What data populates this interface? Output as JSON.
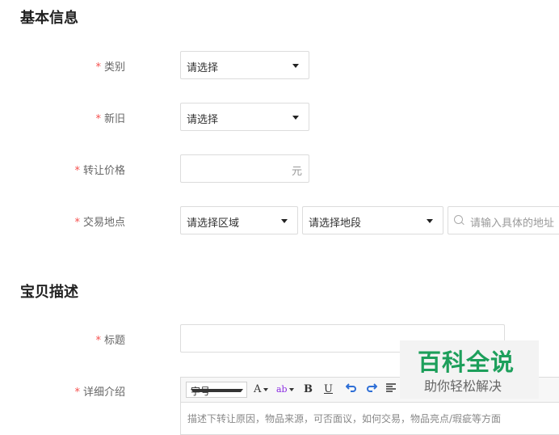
{
  "sections": {
    "basic_info": "基本信息",
    "description": "宝贝描述"
  },
  "required_mark": "*",
  "fields": {
    "category": {
      "label": "类别",
      "value": "请选择"
    },
    "condition": {
      "label": "新旧",
      "value": "请选择"
    },
    "price": {
      "label": "转让价格",
      "unit": "元",
      "value": ""
    },
    "location": {
      "label": "交易地点",
      "area": "请选择区域",
      "sector": "请选择地段",
      "address_placeholder": "请输入具体的地址"
    },
    "title": {
      "label": "标题",
      "value": ""
    },
    "details": {
      "label": "详细介绍"
    }
  },
  "editor": {
    "font_size": "字号",
    "font_color": "A",
    "highlight": "ab",
    "bold": "B",
    "underline": "U",
    "undo_icon": "undo-icon",
    "redo_icon": "redo-icon",
    "align_icon": "align-icon",
    "body_hint": "描述下转让原因，物品来源，可否面议，如何交易，物品亮点/瑕疵等方面"
  },
  "watermark": {
    "main": "百科全说",
    "sub": "助你轻松解决"
  },
  "colors": {
    "required": "#f5504e",
    "watermark": "#1d9f5b"
  }
}
